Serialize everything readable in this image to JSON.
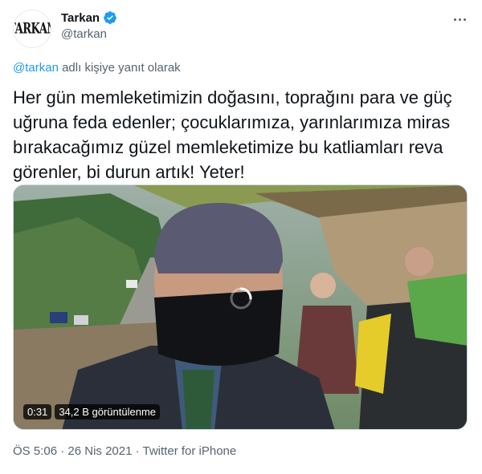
{
  "author": {
    "display_name": "Tarkan",
    "handle": "@tarkan",
    "avatar_text": "TARKAN",
    "verified": true
  },
  "reply": {
    "mention": "@tarkan",
    "suffix": " adlı kişiye yanıt olarak"
  },
  "tweet": {
    "text": "Her gün memleketimizin doğasını, toprağını para ve güç uğruna feda edenler; çocuklarımıza, yarınlarımıza miras bırakacağımız güzel memleketimize bu katliamları reva görenler, bi durun artık! Yeter!"
  },
  "video": {
    "duration": "0:31",
    "views": "34,2 B görüntülenme"
  },
  "meta": {
    "time": "ÖS 5:06",
    "separator": " · ",
    "date": "26 Nis 2021",
    "source": "Twitter for iPhone"
  },
  "colors": {
    "accent": "#1d9bf0",
    "secondary_text": "#536471",
    "primary_text": "#0f1419"
  },
  "icons": [
    "verified-badge-icon",
    "more-options-icon",
    "loading-spinner-icon"
  ]
}
